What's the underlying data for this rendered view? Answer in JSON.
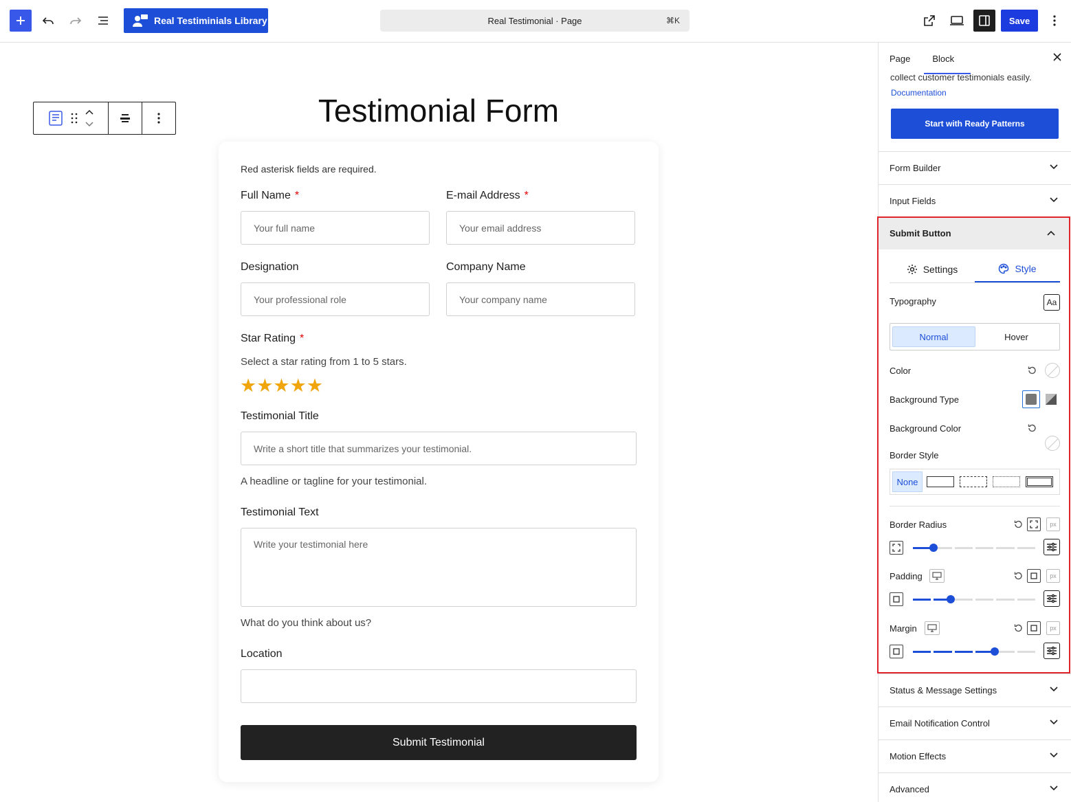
{
  "topbar": {
    "library_button": "Real Testiminials Library",
    "command_title": "Real Testimonial · Page",
    "command_shortcut": "⌘K",
    "save_label": "Save"
  },
  "canvas": {
    "page_title": "Testimonial Form",
    "form": {
      "required_note": "Red asterisk fields are required.",
      "required_mark": "*",
      "full_name": {
        "label": "Full Name",
        "placeholder": "Your full name"
      },
      "email": {
        "label": "E-mail Address",
        "placeholder": "Your email address"
      },
      "designation": {
        "label": "Designation",
        "placeholder": "Your professional role"
      },
      "company": {
        "label": "Company Name",
        "placeholder": "Your company name"
      },
      "star_rating": {
        "label": "Star Rating",
        "help": "Select a star rating from 1 to 5 stars.",
        "stars": "★★★★★"
      },
      "title": {
        "label": "Testimonial Title",
        "placeholder": "Write a short title that summarizes your testimonial.",
        "help": "A headline or tagline for your testimonial."
      },
      "text": {
        "label": "Testimonial Text",
        "placeholder": "Write your testimonial here",
        "help": "What do you think about us?"
      },
      "location": {
        "label": "Location",
        "placeholder": ""
      },
      "submit_label": "Submit Testimonial"
    }
  },
  "sidebar": {
    "tabs": {
      "page": "Page",
      "block": "Block"
    },
    "intro_text": "collect customer testimonials easily.",
    "documentation_link": "Documentation",
    "ready_patterns_button": "Start with Ready Patterns",
    "panels_top": [
      "Form Builder",
      "Input Fields"
    ],
    "submit_panel": {
      "title": "Submit Button",
      "tab_settings": "Settings",
      "tab_style": "Style",
      "typography_label": "Typography",
      "typography_icon": "Aa",
      "state_normal": "Normal",
      "state_hover": "Hover",
      "color_label": "Color",
      "bg_type_label": "Background Type",
      "bg_color_label": "Background Color",
      "border_style_label": "Border Style",
      "border_none": "None",
      "border_radius_label": "Border Radius",
      "padding_label": "Padding",
      "margin_label": "Margin",
      "unit": "px",
      "border_radius_level": 0.17,
      "padding_level": 0.31,
      "margin_level": 0.67
    },
    "panels_bottom": [
      "Status & Message Settings",
      "Email Notification Control",
      "Motion Effects",
      "Advanced"
    ]
  }
}
